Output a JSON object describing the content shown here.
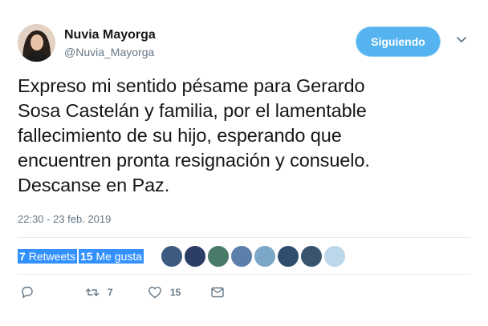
{
  "user": {
    "display_name": "Nuvia Mayorga",
    "handle": "@Nuvia_Mayorga",
    "avatar_icon": "profile-photo"
  },
  "follow_button": {
    "label": "Siguiendo",
    "color": "#55b4f0"
  },
  "tweet": {
    "lines": [
      "Expreso mi sentido pésame para Gerardo",
      "Sosa Castelán y familia, por el lamentable",
      "fallecimiento de su hijo, esperando que",
      "encuentren pronta resignación y consuelo.",
      "Descanse en Paz."
    ],
    "timestamp": "22:30 - 23 feb. 2019"
  },
  "stats": {
    "retweets_count": "7",
    "retweets_label": "Retweets",
    "likes_count": "15",
    "likes_label": "Me gusta"
  },
  "actions": {
    "reply_icon": "reply-icon",
    "retweet_icon": "retweet-icon",
    "retweet_count": "7",
    "like_icon": "heart-icon",
    "like_count": "15",
    "message_icon": "envelope-icon"
  },
  "colors": {
    "selection": "#3390ff",
    "muted": "#657786",
    "divider": "#e6ecf0"
  }
}
